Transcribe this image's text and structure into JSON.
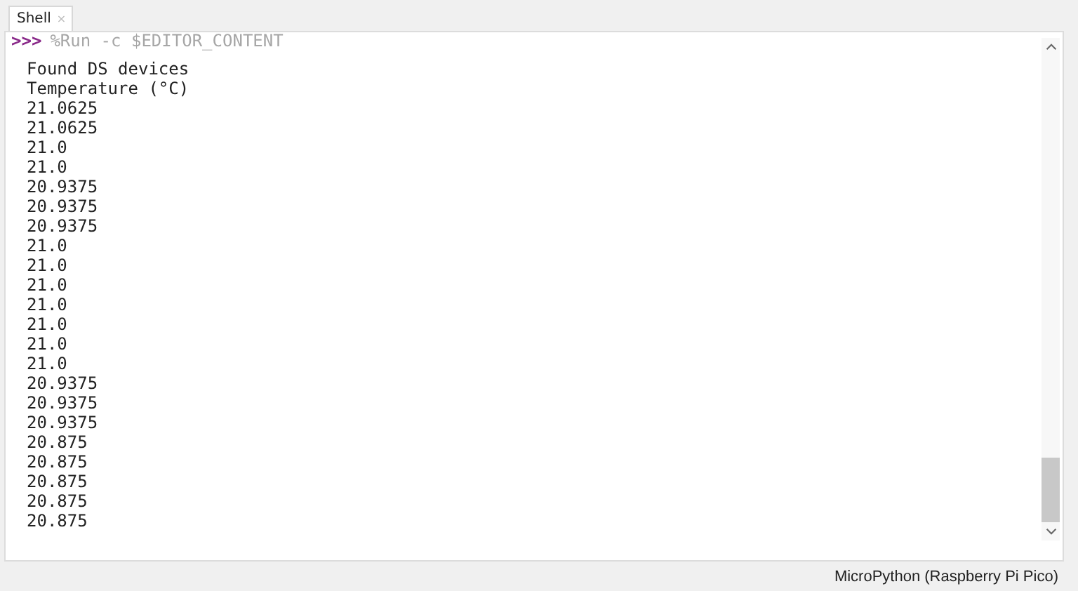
{
  "tabs": [
    {
      "label": "Shell",
      "close": "×",
      "selected": true
    }
  ],
  "shell": {
    "prompt": ">>>",
    "command": "%Run -c $EDITOR_CONTENT",
    "output": [
      "Found DS devices",
      "Temperature (°C)",
      "21.0625",
      "21.0625",
      "21.0",
      "21.0",
      "20.9375",
      "20.9375",
      "20.9375",
      "21.0",
      "21.0",
      "21.0",
      "21.0",
      "21.0",
      "21.0",
      "21.0",
      "20.9375",
      "20.9375",
      "20.9375",
      "20.875",
      "20.875",
      "20.875",
      "20.875",
      "20.875"
    ]
  },
  "status_bar": {
    "interpreter": "MicroPython (Raspberry Pi Pico)"
  }
}
